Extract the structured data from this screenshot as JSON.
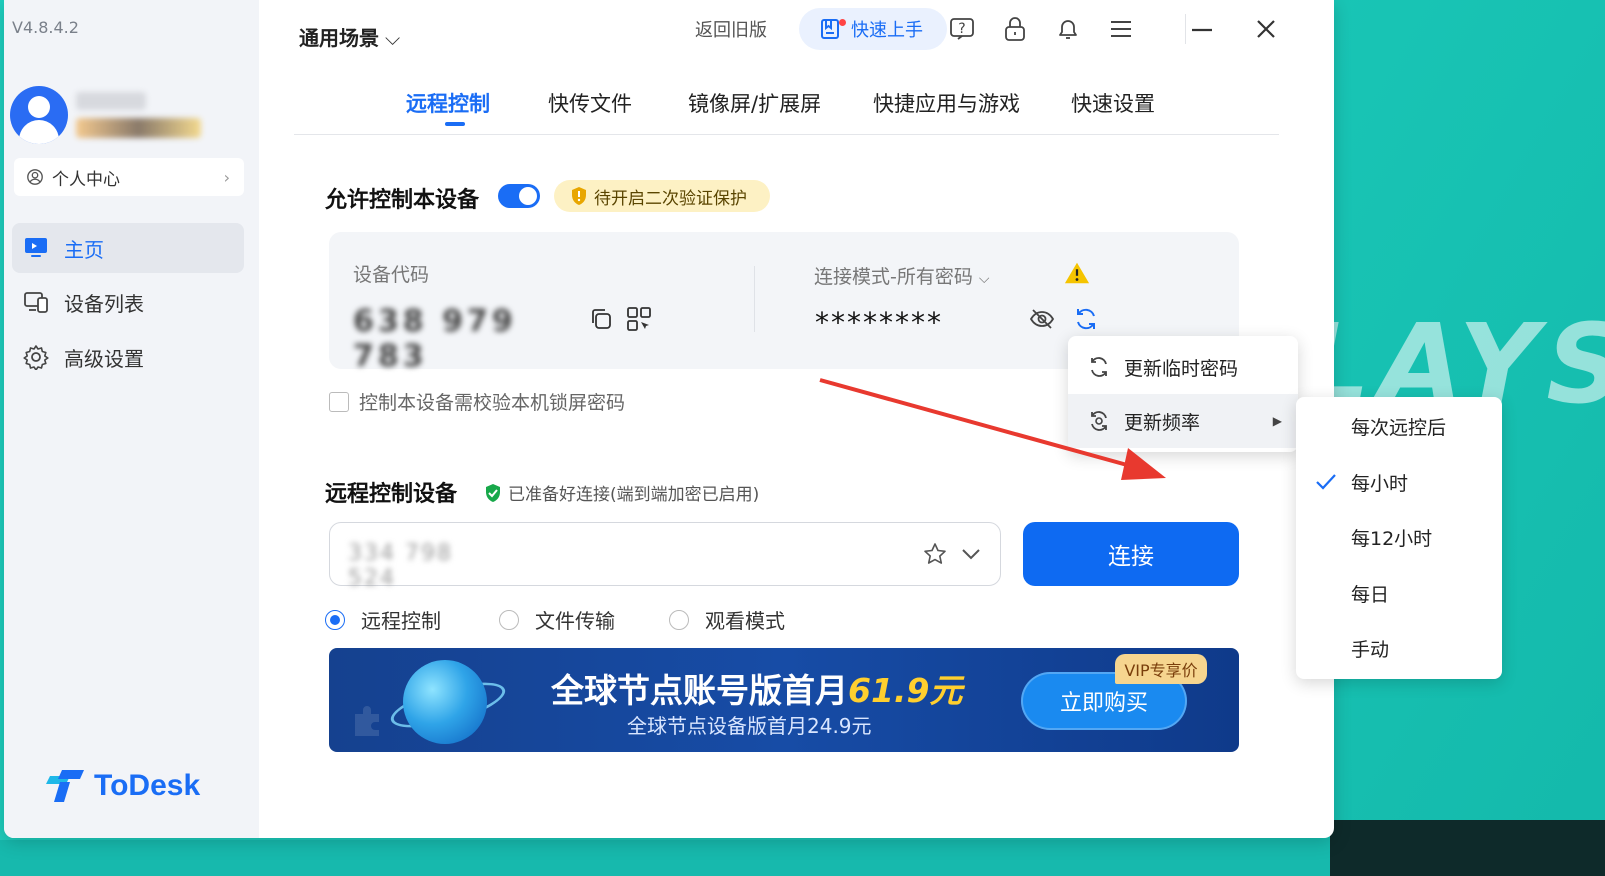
{
  "app": {
    "version": "V4.8.4.2",
    "logo_text": "ToDesk"
  },
  "sidebar": {
    "personal_center": "个人中心",
    "items": [
      {
        "label": "主页",
        "icon": "monitor-icon",
        "active": true
      },
      {
        "label": "设备列表",
        "icon": "devices-icon",
        "active": false
      },
      {
        "label": "高级设置",
        "icon": "gear-icon",
        "active": false
      }
    ]
  },
  "topbar": {
    "scene": "通用场景",
    "back_old": "返回旧版",
    "quick_start": "快速上手",
    "icons": [
      "help-icon",
      "lock-icon",
      "bell-icon",
      "menu-icon",
      "minimize-icon",
      "close-icon"
    ]
  },
  "tabs": [
    {
      "label": "远程控制",
      "active": true
    },
    {
      "label": "快传文件",
      "active": false
    },
    {
      "label": "镜像屏/扩展屏",
      "active": false
    },
    {
      "label": "快捷应用与游戏",
      "active": false
    },
    {
      "label": "快速设置",
      "active": false
    }
  ],
  "allow_control": {
    "title": "允许控制本设备",
    "enabled": true,
    "warning_badge": "待开启二次验证保护",
    "device_code_label": "设备代码",
    "device_code": "638 979 783",
    "mode_label": "连接模式-所有密码",
    "password": "********",
    "lock_screen_check": "控制本设备需校验本机锁屏密码",
    "lock_screen_checked": false
  },
  "remote_control": {
    "title": "远程控制设备",
    "status": "已准备好连接(端到端加密已启用)",
    "input_value": "334 798 524",
    "connect_label": "连接",
    "modes": [
      {
        "label": "远程控制",
        "selected": true
      },
      {
        "label": "文件传输",
        "selected": false
      },
      {
        "label": "观看模式",
        "selected": false
      }
    ]
  },
  "banner": {
    "main_text_prefix": "全球节点账号版首月",
    "main_price": "61.9",
    "main_unit": "元",
    "sub_text": "全球节点设备版首月24.9元",
    "buy_label": "立即购买",
    "vip_tag": "VIP专享价"
  },
  "menu": {
    "items": [
      {
        "label": "更新临时密码",
        "icon": "refresh-icon"
      },
      {
        "label": "更新频率",
        "icon": "refresh-clock-icon",
        "has_submenu": true
      }
    ],
    "submenu": [
      {
        "label": "每次远控后",
        "checked": false
      },
      {
        "label": "每小时",
        "checked": true
      },
      {
        "label": "每12小时",
        "checked": false
      },
      {
        "label": "每日",
        "checked": false
      },
      {
        "label": "手动",
        "checked": false
      }
    ]
  },
  "colors": {
    "accent": "#1a6df5",
    "connect_button": "#0e6af2",
    "warning_badge_bg": "#fdf1c4",
    "desktop_bg": "#1fd1c2",
    "annotation_arrow": "#e8392f"
  }
}
